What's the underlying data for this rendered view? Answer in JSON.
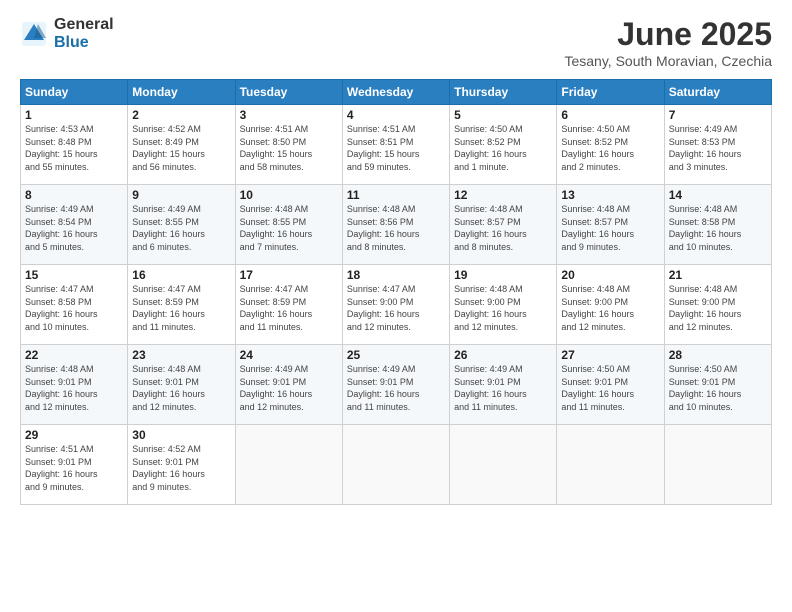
{
  "logo": {
    "general": "General",
    "blue": "Blue"
  },
  "title": "June 2025",
  "subtitle": "Tesany, South Moravian, Czechia",
  "days_header": [
    "Sunday",
    "Monday",
    "Tuesday",
    "Wednesday",
    "Thursday",
    "Friday",
    "Saturday"
  ],
  "weeks": [
    [
      {
        "day": "1",
        "info": "Sunrise: 4:53 AM\nSunset: 8:48 PM\nDaylight: 15 hours\nand 55 minutes."
      },
      {
        "day": "2",
        "info": "Sunrise: 4:52 AM\nSunset: 8:49 PM\nDaylight: 15 hours\nand 56 minutes."
      },
      {
        "day": "3",
        "info": "Sunrise: 4:51 AM\nSunset: 8:50 PM\nDaylight: 15 hours\nand 58 minutes."
      },
      {
        "day": "4",
        "info": "Sunrise: 4:51 AM\nSunset: 8:51 PM\nDaylight: 15 hours\nand 59 minutes."
      },
      {
        "day": "5",
        "info": "Sunrise: 4:50 AM\nSunset: 8:52 PM\nDaylight: 16 hours\nand 1 minute."
      },
      {
        "day": "6",
        "info": "Sunrise: 4:50 AM\nSunset: 8:52 PM\nDaylight: 16 hours\nand 2 minutes."
      },
      {
        "day": "7",
        "info": "Sunrise: 4:49 AM\nSunset: 8:53 PM\nDaylight: 16 hours\nand 3 minutes."
      }
    ],
    [
      {
        "day": "8",
        "info": "Sunrise: 4:49 AM\nSunset: 8:54 PM\nDaylight: 16 hours\nand 5 minutes."
      },
      {
        "day": "9",
        "info": "Sunrise: 4:49 AM\nSunset: 8:55 PM\nDaylight: 16 hours\nand 6 minutes."
      },
      {
        "day": "10",
        "info": "Sunrise: 4:48 AM\nSunset: 8:55 PM\nDaylight: 16 hours\nand 7 minutes."
      },
      {
        "day": "11",
        "info": "Sunrise: 4:48 AM\nSunset: 8:56 PM\nDaylight: 16 hours\nand 8 minutes."
      },
      {
        "day": "12",
        "info": "Sunrise: 4:48 AM\nSunset: 8:57 PM\nDaylight: 16 hours\nand 8 minutes."
      },
      {
        "day": "13",
        "info": "Sunrise: 4:48 AM\nSunset: 8:57 PM\nDaylight: 16 hours\nand 9 minutes."
      },
      {
        "day": "14",
        "info": "Sunrise: 4:48 AM\nSunset: 8:58 PM\nDaylight: 16 hours\nand 10 minutes."
      }
    ],
    [
      {
        "day": "15",
        "info": "Sunrise: 4:47 AM\nSunset: 8:58 PM\nDaylight: 16 hours\nand 10 minutes."
      },
      {
        "day": "16",
        "info": "Sunrise: 4:47 AM\nSunset: 8:59 PM\nDaylight: 16 hours\nand 11 minutes."
      },
      {
        "day": "17",
        "info": "Sunrise: 4:47 AM\nSunset: 8:59 PM\nDaylight: 16 hours\nand 11 minutes."
      },
      {
        "day": "18",
        "info": "Sunrise: 4:47 AM\nSunset: 9:00 PM\nDaylight: 16 hours\nand 12 minutes."
      },
      {
        "day": "19",
        "info": "Sunrise: 4:48 AM\nSunset: 9:00 PM\nDaylight: 16 hours\nand 12 minutes."
      },
      {
        "day": "20",
        "info": "Sunrise: 4:48 AM\nSunset: 9:00 PM\nDaylight: 16 hours\nand 12 minutes."
      },
      {
        "day": "21",
        "info": "Sunrise: 4:48 AM\nSunset: 9:00 PM\nDaylight: 16 hours\nand 12 minutes."
      }
    ],
    [
      {
        "day": "22",
        "info": "Sunrise: 4:48 AM\nSunset: 9:01 PM\nDaylight: 16 hours\nand 12 minutes."
      },
      {
        "day": "23",
        "info": "Sunrise: 4:48 AM\nSunset: 9:01 PM\nDaylight: 16 hours\nand 12 minutes."
      },
      {
        "day": "24",
        "info": "Sunrise: 4:49 AM\nSunset: 9:01 PM\nDaylight: 16 hours\nand 12 minutes."
      },
      {
        "day": "25",
        "info": "Sunrise: 4:49 AM\nSunset: 9:01 PM\nDaylight: 16 hours\nand 11 minutes."
      },
      {
        "day": "26",
        "info": "Sunrise: 4:49 AM\nSunset: 9:01 PM\nDaylight: 16 hours\nand 11 minutes."
      },
      {
        "day": "27",
        "info": "Sunrise: 4:50 AM\nSunset: 9:01 PM\nDaylight: 16 hours\nand 11 minutes."
      },
      {
        "day": "28",
        "info": "Sunrise: 4:50 AM\nSunset: 9:01 PM\nDaylight: 16 hours\nand 10 minutes."
      }
    ],
    [
      {
        "day": "29",
        "info": "Sunrise: 4:51 AM\nSunset: 9:01 PM\nDaylight: 16 hours\nand 9 minutes."
      },
      {
        "day": "30",
        "info": "Sunrise: 4:52 AM\nSunset: 9:01 PM\nDaylight: 16 hours\nand 9 minutes."
      },
      {
        "day": "",
        "info": ""
      },
      {
        "day": "",
        "info": ""
      },
      {
        "day": "",
        "info": ""
      },
      {
        "day": "",
        "info": ""
      },
      {
        "day": "",
        "info": ""
      }
    ]
  ]
}
